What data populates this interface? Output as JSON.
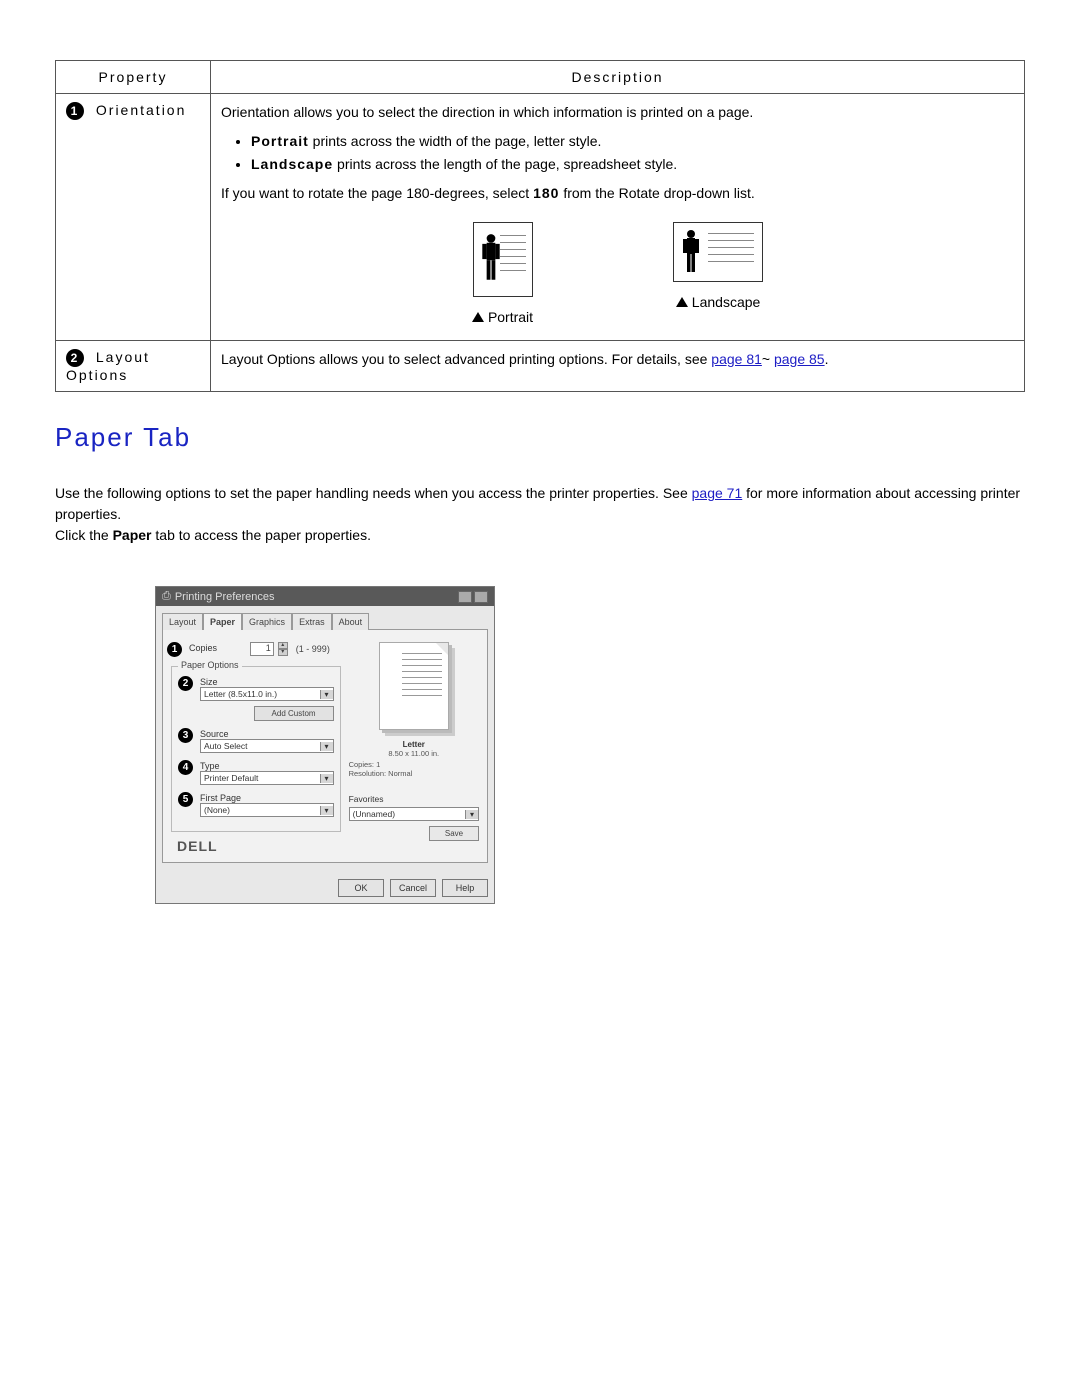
{
  "table": {
    "headers": {
      "property": "Property",
      "description": "Description"
    },
    "rows": [
      {
        "num": "1",
        "property": "Orientation",
        "desc_intro": "Orientation allows you to select the direction in which information is printed on a page.",
        "bullets_bold": [
          "Portrait",
          "Landscape"
        ],
        "bullets_rest": [
          " prints across the width of the page, letter style.",
          " prints across the length of the page, spreadsheet style."
        ],
        "desc_rotate_pre": "If you want to rotate the page 180-degrees, select ",
        "desc_rotate_bold": "180",
        "desc_rotate_post": " from the Rotate drop-down list.",
        "illust": {
          "portrait": "Portrait",
          "landscape": "Landscape"
        }
      },
      {
        "num": "2",
        "property": "Layout Options",
        "desc_pre": "Layout Options allows you to select advanced printing options. For details, see ",
        "link1": "page 81",
        "sep": "~ ",
        "link2": "page 85",
        "desc_post": "."
      }
    ]
  },
  "heading": "Paper Tab",
  "body": {
    "para1_pre": "Use the following options to set the paper handling needs when you access the printer properties. See ",
    "para1_link": "page 71",
    "para1_post": " for more information about accessing printer properties.",
    "para2_pre": "Click the ",
    "para2_bold": "Paper",
    "para2_post": " tab to access the paper properties."
  },
  "dialog": {
    "title": "Printing Preferences",
    "tabs": [
      "Layout",
      "Paper",
      "Graphics",
      "Extras",
      "About"
    ],
    "active_tab": 1,
    "copies_label": "Copies",
    "copies_value": "1",
    "copies_range": "(1 - 999)",
    "group_title": "Paper Options",
    "size_label": "Size",
    "size_value": "Letter (8.5x11.0 in.)",
    "add_custom": "Add Custom",
    "source_label": "Source",
    "source_value": "Auto Select",
    "type_label": "Type",
    "type_value": "Printer Default",
    "firstpage_label": "First Page",
    "firstpage_value": "(None)",
    "preview_name": "Letter",
    "preview_dim": "8.50 x 11.00 in.",
    "preview_copies": "Copies: 1",
    "preview_res": "Resolution: Normal",
    "favorites_label": "Favorites",
    "favorites_value": "(Unnamed)",
    "save": "Save",
    "logo": "DELL",
    "ok": "OK",
    "cancel": "Cancel",
    "help": "Help"
  }
}
